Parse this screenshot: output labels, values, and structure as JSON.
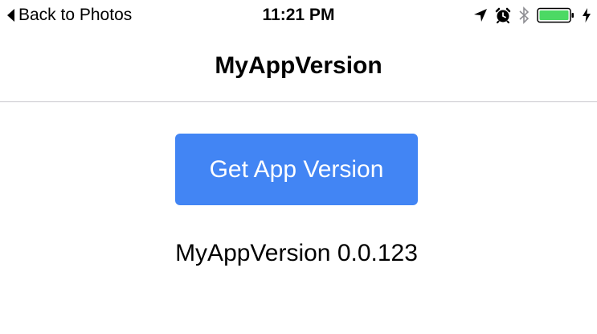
{
  "status_bar": {
    "back_label": "Back to Photos",
    "time": "11:21 PM",
    "icons": [
      "location-arrow-icon",
      "alarm-icon",
      "bluetooth-icon",
      "battery-icon",
      "charging-bolt-icon"
    ],
    "battery_color": "#4cd964"
  },
  "nav": {
    "title": "MyAppVersion"
  },
  "main": {
    "button_label": "Get App Version",
    "button_color": "#4285f4",
    "version_text": "MyAppVersion 0.0.123"
  }
}
